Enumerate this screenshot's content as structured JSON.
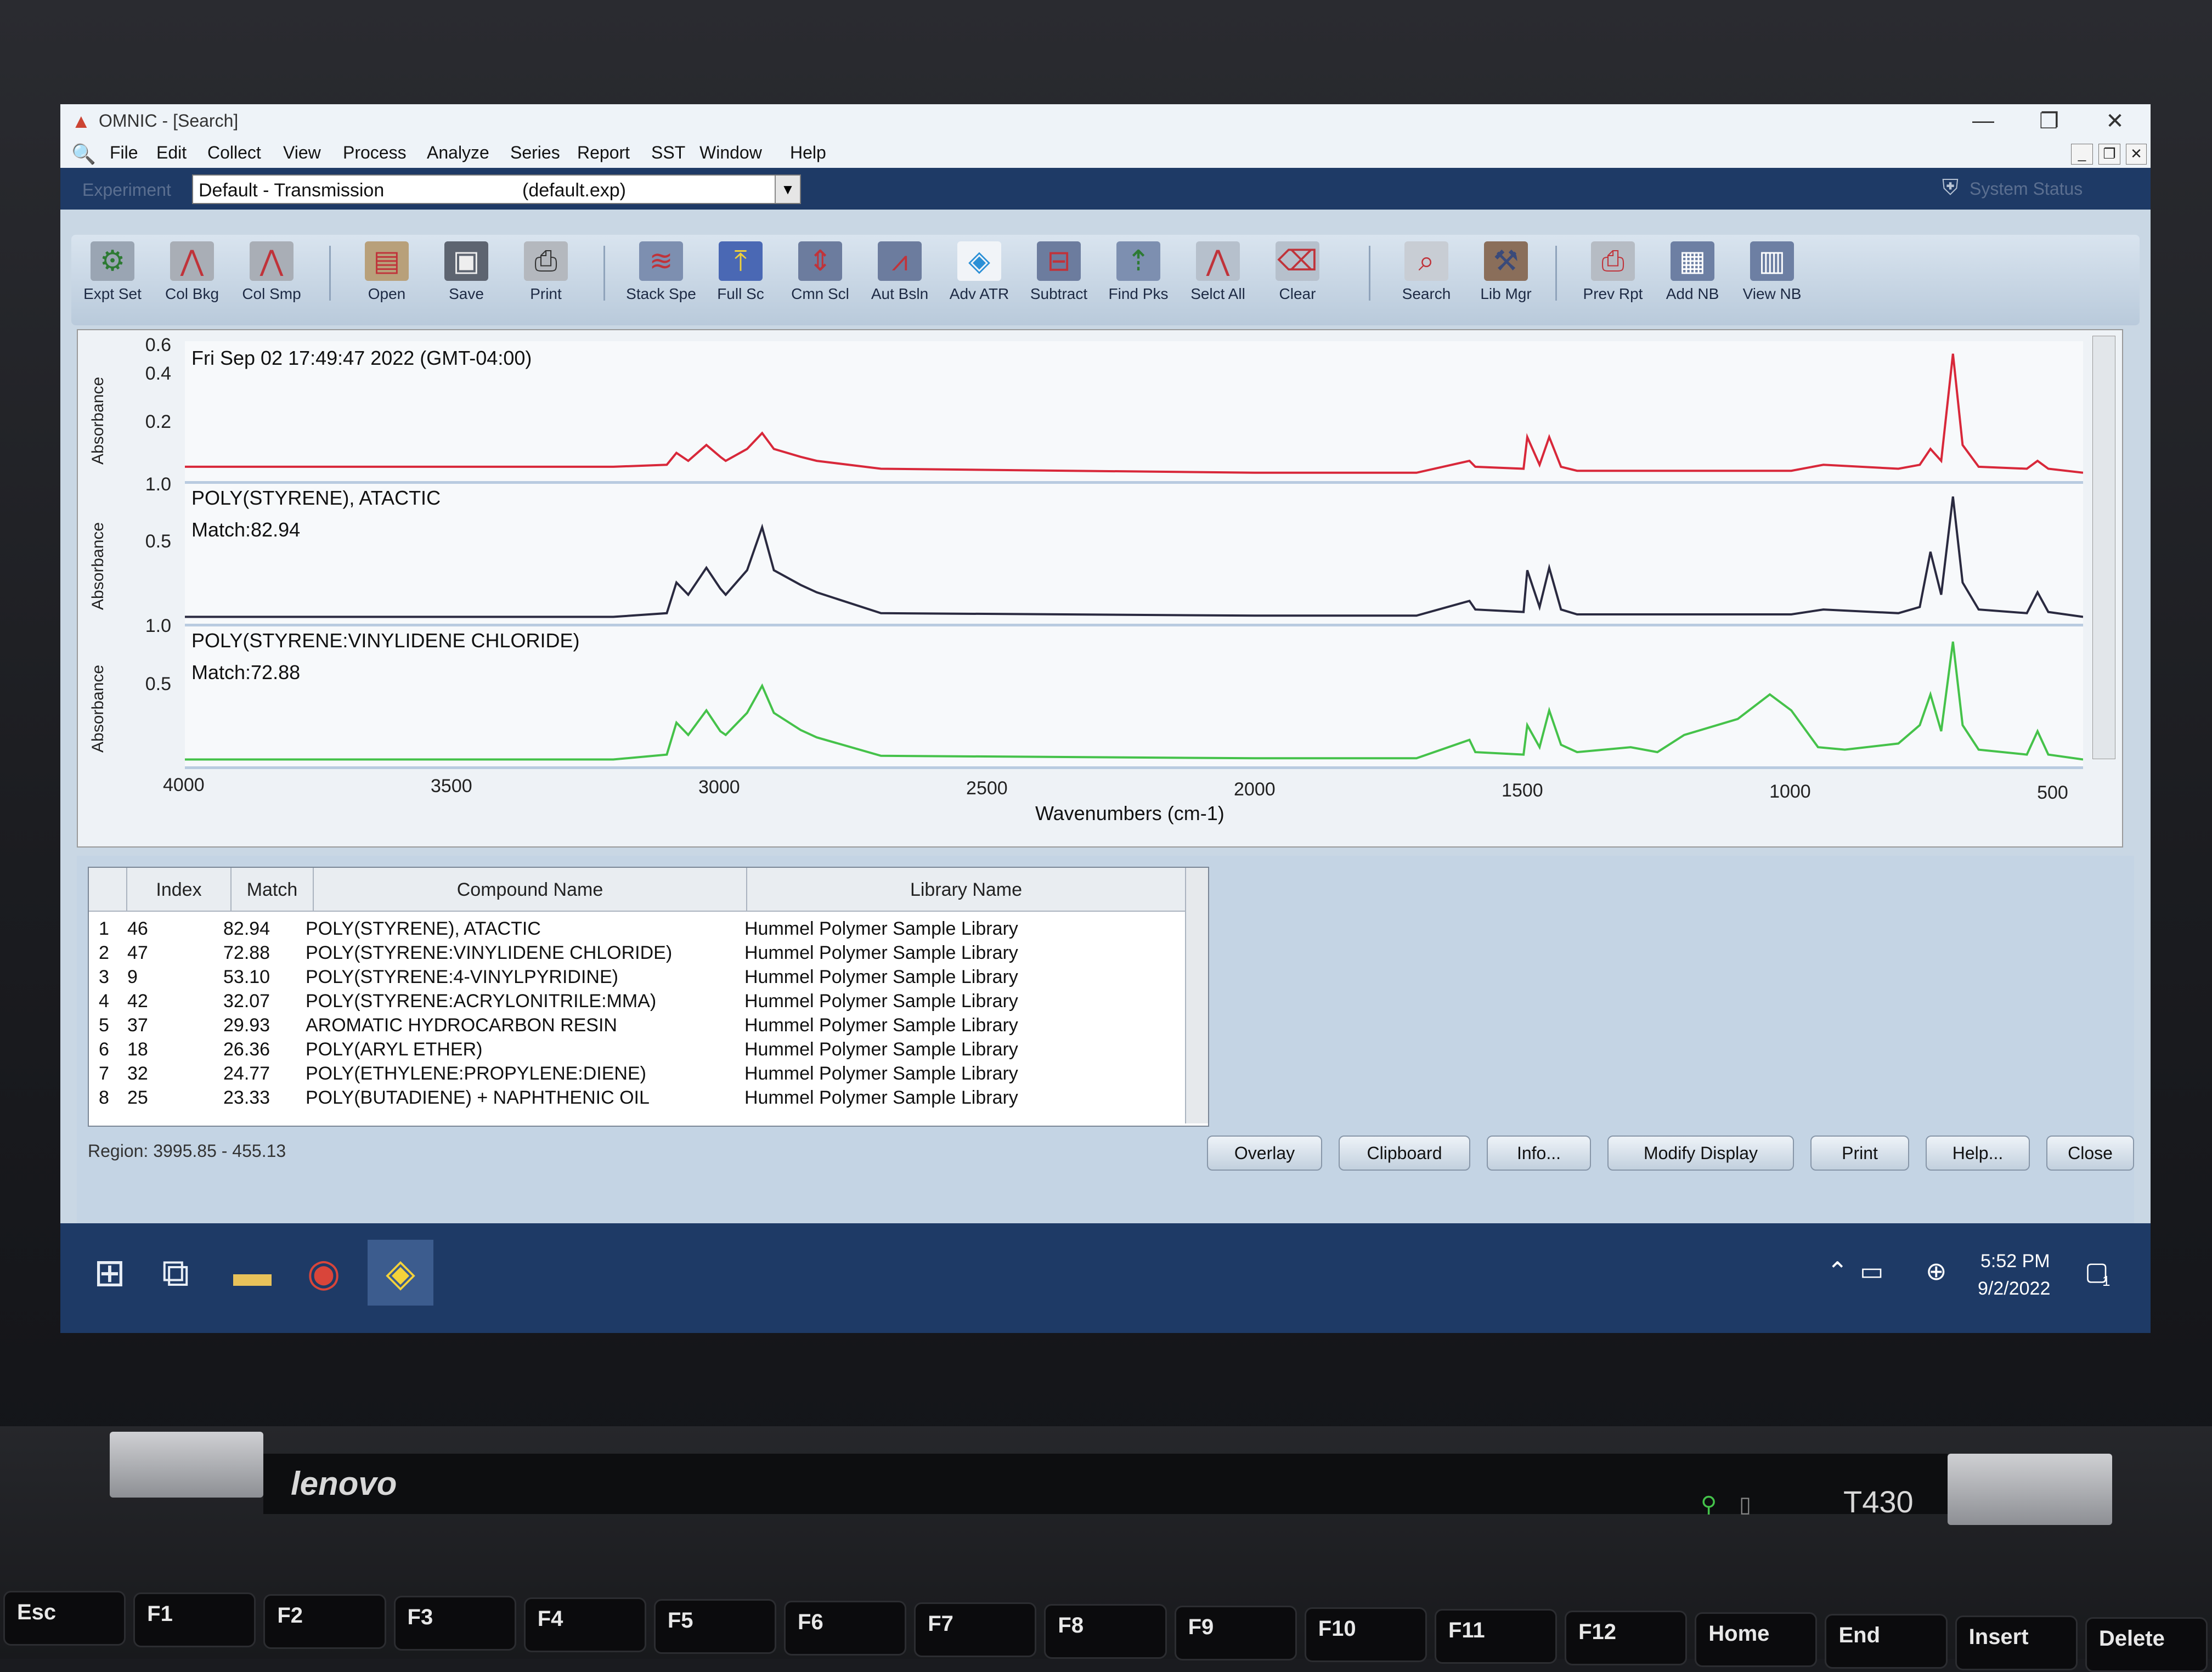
{
  "window": {
    "title": "OMNIC - [Search]",
    "controls": {
      "minimize": "—",
      "restore": "❐",
      "close": "✕"
    },
    "mdi_controls": {
      "minimize": "_",
      "restore": "❐",
      "close": "✕"
    }
  },
  "menu": [
    "File",
    "Edit",
    "Collect",
    "View",
    "Process",
    "Analyze",
    "Series",
    "Report",
    "SST",
    "Window",
    "Help"
  ],
  "experiment": {
    "label": "Experiment",
    "value": "Default - Transmission",
    "file": "(default.exp)",
    "arrow": "▼",
    "status": "System Status"
  },
  "toolbar": [
    {
      "label": "Expt Set",
      "icon": "expt-set-icon"
    },
    {
      "label": "Col Bkg",
      "icon": "col-bkg-icon"
    },
    {
      "label": "Col Smp",
      "icon": "col-smp-icon"
    },
    {
      "label": "Open",
      "icon": "open-icon"
    },
    {
      "label": "Save",
      "icon": "save-icon"
    },
    {
      "label": "Print",
      "icon": "print-icon"
    },
    {
      "label": "Stack Spe",
      "icon": "stack-spectra-icon"
    },
    {
      "label": "Full Sc",
      "icon": "full-scale-icon"
    },
    {
      "label": "Cmn Scl",
      "icon": "common-scale-icon"
    },
    {
      "label": "Aut Bsln",
      "icon": "auto-baseline-icon"
    },
    {
      "label": "Adv ATR",
      "icon": "adv-atr-icon"
    },
    {
      "label": "Subtract",
      "icon": "subtract-icon"
    },
    {
      "label": "Find Pks",
      "icon": "find-peaks-icon"
    },
    {
      "label": "Selct All",
      "icon": "select-all-icon"
    },
    {
      "label": "Clear",
      "icon": "clear-icon"
    },
    {
      "label": "Search",
      "icon": "search-icon"
    },
    {
      "label": "Lib Mgr",
      "icon": "library-manager-icon"
    },
    {
      "label": "Prev Rpt",
      "icon": "preview-report-icon"
    },
    {
      "label": "Add NB",
      "icon": "add-notebook-icon"
    },
    {
      "label": "View NB",
      "icon": "view-notebook-icon"
    }
  ],
  "chart_data": {
    "type": "line",
    "xlabel": "Wavenumbers (cm-1)",
    "xlim": [
      4000,
      455
    ],
    "x_ticks": [
      4000,
      3500,
      3000,
      2500,
      2000,
      1500,
      1000,
      500
    ],
    "panels": [
      {
        "ylabel": "Absorbance",
        "y_ticks": [
          "0.6",
          "0.4",
          "0.2"
        ],
        "ylim": [
          0,
          0.65
        ],
        "header": "Fri Sep 02 17:49:47 2022 (GMT-04:00)",
        "match": "",
        "color": "#d8283a",
        "series": {
          "x": [
            4000,
            3200,
            3100,
            3082,
            3060,
            3026,
            3000,
            2990,
            2950,
            2922,
            2900,
            2850,
            2820,
            2700,
            2000,
            1700,
            1601,
            1590,
            1500,
            1493,
            1470,
            1452,
            1430,
            1400,
            1000,
            940,
            800,
            760,
            740,
            720,
            698,
            680,
            650,
            560,
            540,
            520,
            455
          ],
          "y": [
            0.05,
            0.05,
            0.06,
            0.12,
            0.08,
            0.16,
            0.1,
            0.08,
            0.14,
            0.22,
            0.14,
            0.1,
            0.08,
            0.04,
            0.02,
            0.02,
            0.08,
            0.05,
            0.04,
            0.2,
            0.06,
            0.2,
            0.05,
            0.03,
            0.03,
            0.06,
            0.04,
            0.06,
            0.14,
            0.08,
            0.62,
            0.16,
            0.05,
            0.04,
            0.08,
            0.04,
            0.02
          ]
        }
      },
      {
        "ylabel": "Absorbance",
        "y_ticks": [
          "1.0",
          "0.5"
        ],
        "ylim": [
          0,
          1.05
        ],
        "header": "POLY(STYRENE), ATACTIC",
        "match": "Match:82.94",
        "color": "#2a2a40",
        "series": {
          "x": [
            4000,
            3200,
            3100,
            3082,
            3060,
            3026,
            3000,
            2990,
            2950,
            2922,
            2900,
            2850,
            2820,
            2700,
            2000,
            1700,
            1601,
            1590,
            1500,
            1493,
            1470,
            1452,
            1430,
            1400,
            1000,
            940,
            800,
            760,
            740,
            720,
            698,
            680,
            650,
            560,
            540,
            520,
            455
          ],
          "y": [
            0.02,
            0.02,
            0.05,
            0.3,
            0.2,
            0.42,
            0.25,
            0.2,
            0.4,
            0.75,
            0.4,
            0.28,
            0.22,
            0.05,
            0.03,
            0.03,
            0.15,
            0.08,
            0.06,
            0.4,
            0.1,
            0.42,
            0.08,
            0.04,
            0.04,
            0.08,
            0.05,
            0.1,
            0.55,
            0.2,
            1.0,
            0.3,
            0.08,
            0.05,
            0.22,
            0.06,
            0.02
          ]
        }
      },
      {
        "ylabel": "Absorbance",
        "y_ticks": [
          "1.0",
          "0.5"
        ],
        "ylim": [
          0,
          1.05
        ],
        "header": "POLY(STYRENE:VINYLIDENE CHLORIDE)",
        "match": "Match:72.88",
        "color": "#45c24a",
        "series": {
          "x": [
            4000,
            3200,
            3100,
            3082,
            3060,
            3026,
            3000,
            2990,
            2950,
            2922,
            2900,
            2850,
            2820,
            2700,
            2000,
            1700,
            1601,
            1590,
            1500,
            1493,
            1470,
            1452,
            1430,
            1400,
            1300,
            1250,
            1200,
            1100,
            1040,
            1000,
            950,
            900,
            800,
            760,
            740,
            720,
            698,
            680,
            650,
            560,
            540,
            520,
            455
          ],
          "y": [
            0.02,
            0.02,
            0.06,
            0.32,
            0.22,
            0.42,
            0.25,
            0.22,
            0.4,
            0.62,
            0.4,
            0.26,
            0.2,
            0.05,
            0.03,
            0.03,
            0.18,
            0.08,
            0.06,
            0.3,
            0.12,
            0.42,
            0.14,
            0.08,
            0.12,
            0.08,
            0.22,
            0.35,
            0.55,
            0.42,
            0.12,
            0.1,
            0.15,
            0.3,
            0.55,
            0.25,
            0.98,
            0.3,
            0.1,
            0.06,
            0.25,
            0.06,
            0.02
          ]
        }
      }
    ]
  },
  "results": {
    "columns": [
      "Index",
      "Match",
      "Compound Name",
      "Library Name"
    ],
    "rows": [
      {
        "n": "1",
        "index": "46",
        "match": "82.94",
        "name": "POLY(STYRENE), ATACTIC",
        "library": "Hummel Polymer Sample Library"
      },
      {
        "n": "2",
        "index": "47",
        "match": "72.88",
        "name": "POLY(STYRENE:VINYLIDENE CHLORIDE)",
        "library": "Hummel Polymer Sample Library"
      },
      {
        "n": "3",
        "index": "9",
        "match": "53.10",
        "name": "POLY(STYRENE:4-VINYLPYRIDINE)",
        "library": "Hummel Polymer Sample Library"
      },
      {
        "n": "4",
        "index": "42",
        "match": "32.07",
        "name": "POLY(STYRENE:ACRYLONITRILE:MMA)",
        "library": "Hummel Polymer Sample Library"
      },
      {
        "n": "5",
        "index": "37",
        "match": "29.93",
        "name": "AROMATIC HYDROCARBON RESIN",
        "library": "Hummel Polymer Sample Library"
      },
      {
        "n": "6",
        "index": "18",
        "match": "26.36",
        "name": "POLY(ARYL ETHER)",
        "library": "Hummel Polymer Sample Library"
      },
      {
        "n": "7",
        "index": "32",
        "match": "24.77",
        "name": "POLY(ETHYLENE:PROPYLENE:DIENE)",
        "library": "Hummel Polymer Sample Library"
      },
      {
        "n": "8",
        "index": "25",
        "match": "23.33",
        "name": "POLY(BUTADIENE) + NAPHTHENIC OIL",
        "library": "Hummel Polymer Sample Library"
      }
    ],
    "region": "Region:  3995.85  -  455.13",
    "buttons": [
      "Overlay",
      "Clipboard",
      "Info...",
      "Modify Display",
      "Print",
      "Help...",
      "Close"
    ]
  },
  "taskbar": {
    "time": "5:52 PM",
    "date": "9/2/2022",
    "notifications": "1"
  },
  "laptop": {
    "brand": "lenovo",
    "model": "T430",
    "keys": [
      "Esc",
      "F1",
      "F2",
      "F3",
      "F4",
      "F5",
      "F6",
      "F7",
      "F8",
      "F9",
      "F10",
      "F11",
      "F12",
      "Home",
      "End",
      "Insert",
      "Delete"
    ]
  }
}
